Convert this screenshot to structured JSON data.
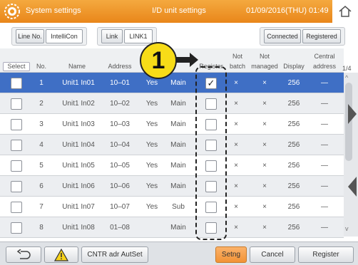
{
  "titlebar": {
    "left": "System settings",
    "center": "I/D unit settings",
    "datetime": "01/09/2016(THU) 01:49"
  },
  "toolbar": {
    "line_no": "Line No.",
    "intellicon": "IntelliCon",
    "link": "Link",
    "link1": "LINK1",
    "connected": "Connected",
    "registered": "Registered"
  },
  "columns": {
    "select": "Select",
    "no": "No.",
    "name": "Name",
    "address": "Address",
    "register": "Register",
    "not_batch_1": "Not",
    "not_batch_2": "batch",
    "not_managed_1": "Not",
    "not_managed_2": "managed",
    "display": "Display",
    "central_1": "Central",
    "central_2": "address"
  },
  "page_indicator": "1/4",
  "rows": [
    {
      "no": "1",
      "name": "Unit1 In01",
      "address": "10–01",
      "yes": "Yes",
      "role": "Main",
      "registered": true,
      "not_batch": "×",
      "not_managed": "×",
      "display": "256",
      "central": "—",
      "selected": true
    },
    {
      "no": "2",
      "name": "Unit1 In02",
      "address": "10–02",
      "yes": "Yes",
      "role": "Main",
      "registered": false,
      "not_batch": "×",
      "not_managed": "×",
      "display": "256",
      "central": "—",
      "selected": false
    },
    {
      "no": "3",
      "name": "Unit1 In03",
      "address": "10–03",
      "yes": "Yes",
      "role": "Main",
      "registered": false,
      "not_batch": "×",
      "not_managed": "×",
      "display": "256",
      "central": "—",
      "selected": false
    },
    {
      "no": "4",
      "name": "Unit1 In04",
      "address": "10–04",
      "yes": "Yes",
      "role": "Main",
      "registered": false,
      "not_batch": "×",
      "not_managed": "×",
      "display": "256",
      "central": "—",
      "selected": false
    },
    {
      "no": "5",
      "name": "Unit1 In05",
      "address": "10–05",
      "yes": "Yes",
      "role": "Main",
      "registered": false,
      "not_batch": "×",
      "not_managed": "×",
      "display": "256",
      "central": "—",
      "selected": false
    },
    {
      "no": "6",
      "name": "Unit1 In06",
      "address": "10–06",
      "yes": "Yes",
      "role": "Main",
      "registered": false,
      "not_batch": "×",
      "not_managed": "×",
      "display": "256",
      "central": "—",
      "selected": false
    },
    {
      "no": "7",
      "name": "Unit1 In07",
      "address": "10–07",
      "yes": "Yes",
      "role": "Sub",
      "registered": false,
      "not_batch": "×",
      "not_managed": "×",
      "display": "256",
      "central": "—",
      "selected": false
    },
    {
      "no": "8",
      "name": "Unit1 In08",
      "address": "01–08",
      "yes": "",
      "role": "Main",
      "registered": false,
      "not_batch": "×",
      "not_managed": "×",
      "display": "256",
      "central": "—",
      "selected": false
    }
  ],
  "callout_number": "1",
  "footer": {
    "cntr": "CNTR adr AutSet",
    "setng": "Setng",
    "cancel": "Cancel",
    "register": "Register"
  },
  "icons": {
    "gear": "gear-icon",
    "home": "home-icon",
    "back": "back-icon",
    "warning": "warning-icon"
  },
  "colors": {
    "title_orange": "#ee951f",
    "selected_row": "#3f6fc5",
    "callout_yellow": "#f7dc18"
  }
}
